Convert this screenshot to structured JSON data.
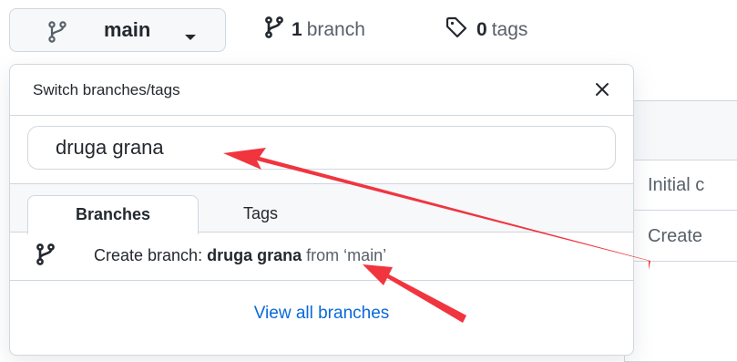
{
  "toolbar": {
    "branch_button_label": "main",
    "branches_count": "1",
    "branches_label": "branch",
    "tags_count": "0",
    "tags_label": "tags"
  },
  "dropdown": {
    "title": "Switch branches/tags",
    "filter_value": "druga grana",
    "tabs": [
      {
        "label": "Branches",
        "active": true
      },
      {
        "label": "Tags",
        "active": false
      }
    ],
    "create_item": {
      "prefix": "Create branch: ",
      "name": "druga grana",
      "suffix": " from ‘main’"
    },
    "view_all_label": "View all branches"
  },
  "background": {
    "rows": [
      "Initial c",
      "Create"
    ]
  },
  "colors": {
    "accent_link": "#0969da",
    "annotation_arrow": "#f0353f",
    "border": "#d0d7de"
  }
}
